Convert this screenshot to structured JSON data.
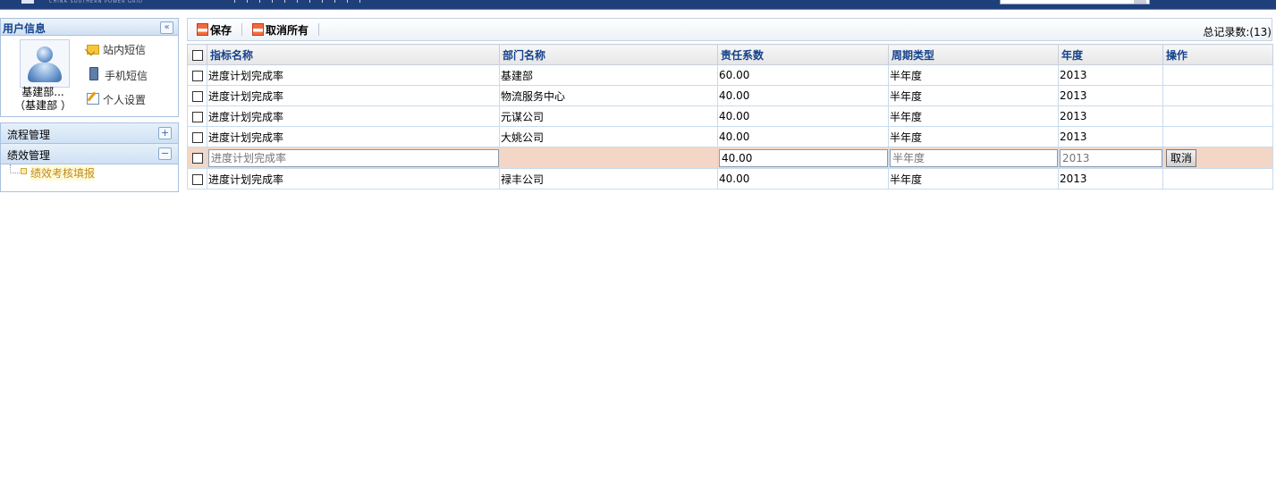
{
  "header": {
    "subtitle": "CHINA SOUTHERN POWER GRID"
  },
  "user_panel": {
    "title": "用户信息",
    "name_line1": "基建部...",
    "name_line2": "（基建部 ）",
    "menu": [
      {
        "label": "站内短信",
        "icon": "mail-icon"
      },
      {
        "label": "手机短信",
        "icon": "mobile-phone-icon"
      },
      {
        "label": "个人设置",
        "icon": "edit-icon"
      }
    ]
  },
  "nav": {
    "process": {
      "label": "流程管理",
      "toggle": "+"
    },
    "performance": {
      "label": "绩效管理",
      "toggle": "−",
      "children": [
        {
          "label": "绩效考核填报"
        }
      ]
    }
  },
  "toolbar": {
    "save_label": "保存",
    "cancel_all_label": "取消所有",
    "total_label": "总记录数:(13)"
  },
  "grid": {
    "columns": [
      "指标名称",
      "部门名称",
      "责任系数",
      "周期类型",
      "年度",
      "操作"
    ],
    "rows": [
      {
        "indicator": "进度计划完成率",
        "dept": "基建部",
        "coef": "60.00",
        "period": "半年度",
        "year": "2013",
        "op": ""
      },
      {
        "indicator": "进度计划完成率",
        "dept": "物流服务中心",
        "coef": "40.00",
        "period": "半年度",
        "year": "2013",
        "op": ""
      },
      {
        "indicator": "进度计划完成率",
        "dept": "元谋公司",
        "coef": "40.00",
        "period": "半年度",
        "year": "2013",
        "op": ""
      },
      {
        "indicator": "进度计划完成率",
        "dept": "大姚公司",
        "coef": "40.00",
        "period": "半年度",
        "year": "2013",
        "op": ""
      }
    ],
    "edit_row": {
      "indicator_placeholder": "进度计划完成率",
      "dept": "",
      "coef_value": "40.00",
      "period_placeholder": "半年度",
      "year_placeholder": "2013",
      "cancel_label": "取消"
    },
    "last_row": {
      "indicator": "进度计划完成率",
      "dept": "禄丰公司",
      "coef": "40.00",
      "period": "半年度",
      "year": "2013",
      "op": ""
    }
  },
  "colors": {
    "header_bg": "#1f3f7a",
    "accent": "#15428b",
    "edit_row_bg": "#f4d6c6"
  }
}
